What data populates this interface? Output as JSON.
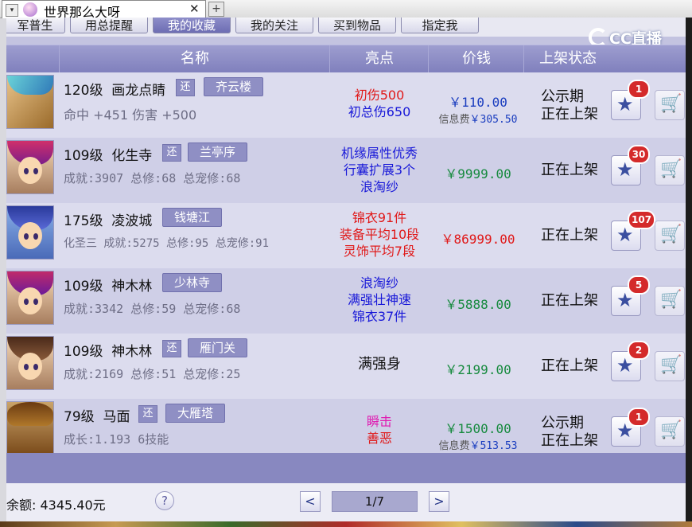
{
  "window": {
    "tab_title": "世界那么大呀",
    "close_glyph": "✕",
    "new_tab_glyph": "+",
    "dropdown_glyph": "▾"
  },
  "watermark": {
    "text": "CC直播"
  },
  "nav_tabs": [
    "军普生",
    "用总提醒",
    "我的收藏",
    "我的关注",
    "买到物品",
    "指定我"
  ],
  "columns": {
    "name": "名称",
    "highlight": "亮点",
    "price": "价钱",
    "status": "上架状态"
  },
  "listings": [
    {
      "level": "120级",
      "name": "画龙点睛",
      "return_tag": "还",
      "server": "齐云楼",
      "stats": "命中 +451 伤害 +500",
      "highlights": [
        {
          "text": "初伤500",
          "color": "red"
        },
        {
          "text": "初总伤650",
          "color": "blue"
        }
      ],
      "price": "￥110.00",
      "price_color": "blue",
      "fee_label": "信息费",
      "fee": "￥305.50",
      "status": [
        "公示期",
        "正在上架"
      ],
      "fav_count": "1"
    },
    {
      "level": "109级",
      "name": "化生寺",
      "return_tag": "还",
      "server": "兰亭序",
      "stats": "成就:3907 总修:68 总宠修:68",
      "highlights": [
        {
          "text": "机缘属性优秀",
          "color": "blue"
        },
        {
          "text": "行囊扩展3个",
          "color": "blue"
        },
        {
          "text": "浪淘纱",
          "color": "blue"
        }
      ],
      "price": "￥9999.00",
      "price_color": "green",
      "fee_label": "",
      "fee": "",
      "status": [
        "正在上架"
      ],
      "fav_count": "30"
    },
    {
      "level": "175级",
      "name": "凌波城",
      "return_tag": "",
      "server": "钱塘江",
      "stats": "化圣三 成就:5275 总修:95 总宠修:91",
      "highlights": [
        {
          "text": "锦衣91件",
          "color": "red"
        },
        {
          "text": "装备平均10段",
          "color": "red"
        },
        {
          "text": "灵饰平均7段",
          "color": "red"
        }
      ],
      "price": "￥86999.00",
      "price_color": "red",
      "fee_label": "",
      "fee": "",
      "status": [
        "正在上架"
      ],
      "fav_count": "107"
    },
    {
      "level": "109级",
      "name": "神木林",
      "return_tag": "",
      "server": "少林寺",
      "stats": "成就:3342 总修:59 总宠修:68",
      "highlights": [
        {
          "text": "浪淘纱",
          "color": "blue"
        },
        {
          "text": "满强壮神速",
          "color": "blue"
        },
        {
          "text": "锦衣37件",
          "color": "blue"
        }
      ],
      "price": "￥5888.00",
      "price_color": "green",
      "fee_label": "",
      "fee": "",
      "status": [
        "正在上架"
      ],
      "fav_count": "5"
    },
    {
      "level": "109级",
      "name": "神木林",
      "return_tag": "还",
      "server": "雁门关",
      "stats": "成就:2169 总修:51 总宠修:25",
      "highlights": [
        {
          "text": "满强身",
          "color": "black"
        }
      ],
      "price": "￥2199.00",
      "price_color": "green",
      "fee_label": "",
      "fee": "",
      "status": [
        "正在上架"
      ],
      "fav_count": "2"
    },
    {
      "level": "79级",
      "name": "马面",
      "return_tag": "还",
      "server": "大雁塔",
      "stats": "成长:1.193 6技能",
      "highlights": [
        {
          "text": "瞬击",
          "color": "pink"
        },
        {
          "text": "善恶",
          "color": "red"
        }
      ],
      "price": "￥1500.00",
      "price_color": "green",
      "fee_label": "信息费",
      "fee": "￥513.53",
      "status": [
        "公示期",
        "正在上架"
      ],
      "fav_count": "1"
    }
  ],
  "footer": {
    "balance": "余额: 4345.40元",
    "help": "?",
    "prev": "<",
    "page": "1/7",
    "next": ">"
  },
  "icons": {
    "favorite": "star-icon",
    "buy": "cart-icon"
  }
}
